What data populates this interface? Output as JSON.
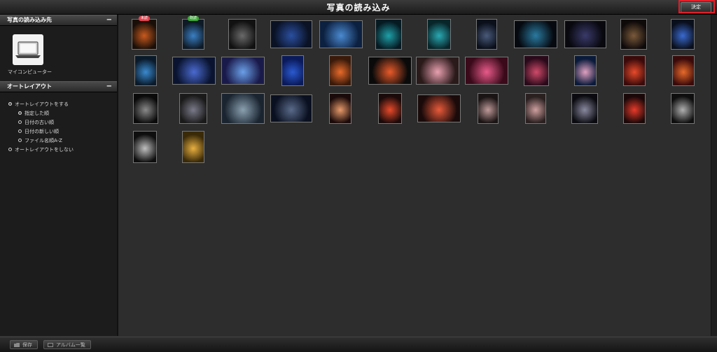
{
  "window": {
    "title": "写真の読み込み"
  },
  "confirm_label": "決定",
  "sidebar": {
    "source_header": "写真の読み込み先",
    "source_item_label": "マイコンピューター",
    "layout_header": "オートレイアウト",
    "collapse_symbol": "−",
    "options": [
      {
        "label": "オートレイアウトをする",
        "level": 1,
        "selected": true
      },
      {
        "label": "指定した順",
        "level": 2,
        "selected": true
      },
      {
        "label": "日付の古い順",
        "level": 2,
        "selected": false
      },
      {
        "label": "日付の新しい順",
        "level": 2,
        "selected": false
      },
      {
        "label": "ファイル名順A-Z",
        "level": 2,
        "selected": false
      },
      {
        "label": "オートレイアウトをしない",
        "level": 1,
        "selected": false
      }
    ]
  },
  "badges": {
    "unread": "未読",
    "read": "既読"
  },
  "colors": {
    "unread_badge": "#e8424f",
    "read_badge": "#3aaa35"
  },
  "bottom": {
    "save_label": "保存",
    "album_label": "アルバム一覧"
  }
}
